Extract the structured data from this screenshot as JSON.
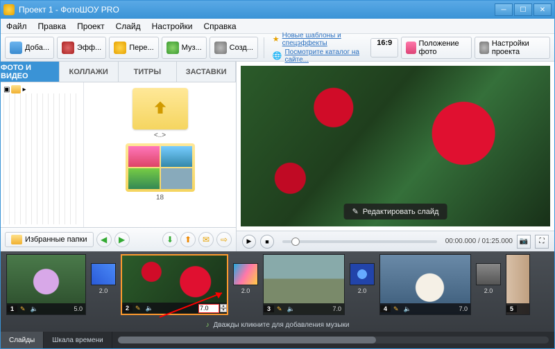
{
  "titlebar": {
    "title": "Проект 1 - ФотоШОУ PRO"
  },
  "menu": {
    "file": "Файл",
    "edit": "Правка",
    "project": "Проект",
    "slide": "Слайд",
    "settings": "Настройки",
    "help": "Справка"
  },
  "toolbar": {
    "add": "Доба...",
    "effects": "Эфф...",
    "transitions": "Пере...",
    "music": "Муз...",
    "create": "Созд...",
    "info1": "Новые шаблоны и спецэффекты",
    "info2": "Посмотрите каталог на сайте...",
    "ratio": "16:9",
    "position": "Положение фото",
    "proj_settings": "Настройки проекта"
  },
  "tabs": {
    "photo": "ФОТО И ВИДЕО",
    "collage": "КОЛЛАЖИ",
    "titles": "ТИТРЫ",
    "splash": "ЗАСТАВКИ"
  },
  "browser": {
    "up_label": "<..>",
    "item_label": "18",
    "favorites": "Избранные папки"
  },
  "preview": {
    "edit_slide": "Редактировать слайд"
  },
  "player": {
    "time": "00:00.000 / 01:25.000"
  },
  "timeline": {
    "slides": [
      {
        "num": "1",
        "dur": "5.0"
      },
      {
        "num": "2",
        "dur": "7.0"
      },
      {
        "num": "3",
        "dur": "7.0"
      },
      {
        "num": "4",
        "dur": "7.0"
      },
      {
        "num": "5",
        "dur": ""
      }
    ],
    "transitions": [
      {
        "dur": "2.0"
      },
      {
        "dur": "2.0"
      },
      {
        "dur": "2.0"
      },
      {
        "dur": "2.0"
      }
    ],
    "music_hint": "Дважды кликните для добавления музыки",
    "tab_slides": "Слайды",
    "tab_timeline": "Шкала времени"
  }
}
